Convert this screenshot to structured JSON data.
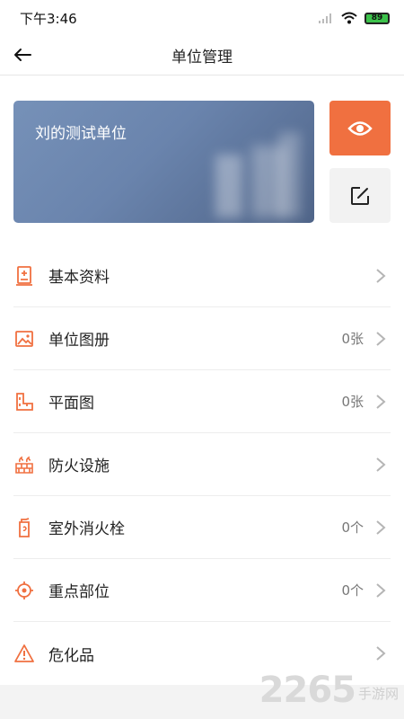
{
  "status": {
    "time": "下午3:46",
    "battery": "89"
  },
  "nav": {
    "title": "单位管理"
  },
  "card": {
    "unit_name": "刘的测试单位"
  },
  "menu": [
    {
      "label": "基本资料",
      "count": ""
    },
    {
      "label": "单位图册",
      "count": "0张"
    },
    {
      "label": "平面图",
      "count": "0张"
    },
    {
      "label": "防火设施",
      "count": ""
    },
    {
      "label": "室外消火栓",
      "count": "0个"
    },
    {
      "label": "重点部位",
      "count": "0个"
    },
    {
      "label": "危化品",
      "count": ""
    }
  ],
  "watermark": {
    "number": "2265",
    "text": "手游网"
  },
  "colors": {
    "accent": "#f07040",
    "card": "#6a84ad"
  },
  "icons": {
    "back": "arrow-left-icon",
    "view": "eye-icon",
    "edit": "edit-icon",
    "menu": [
      "document-icon",
      "image-icon",
      "floorplan-icon",
      "firewall-icon",
      "hydrant-icon",
      "target-icon",
      "warning-icon"
    ]
  }
}
